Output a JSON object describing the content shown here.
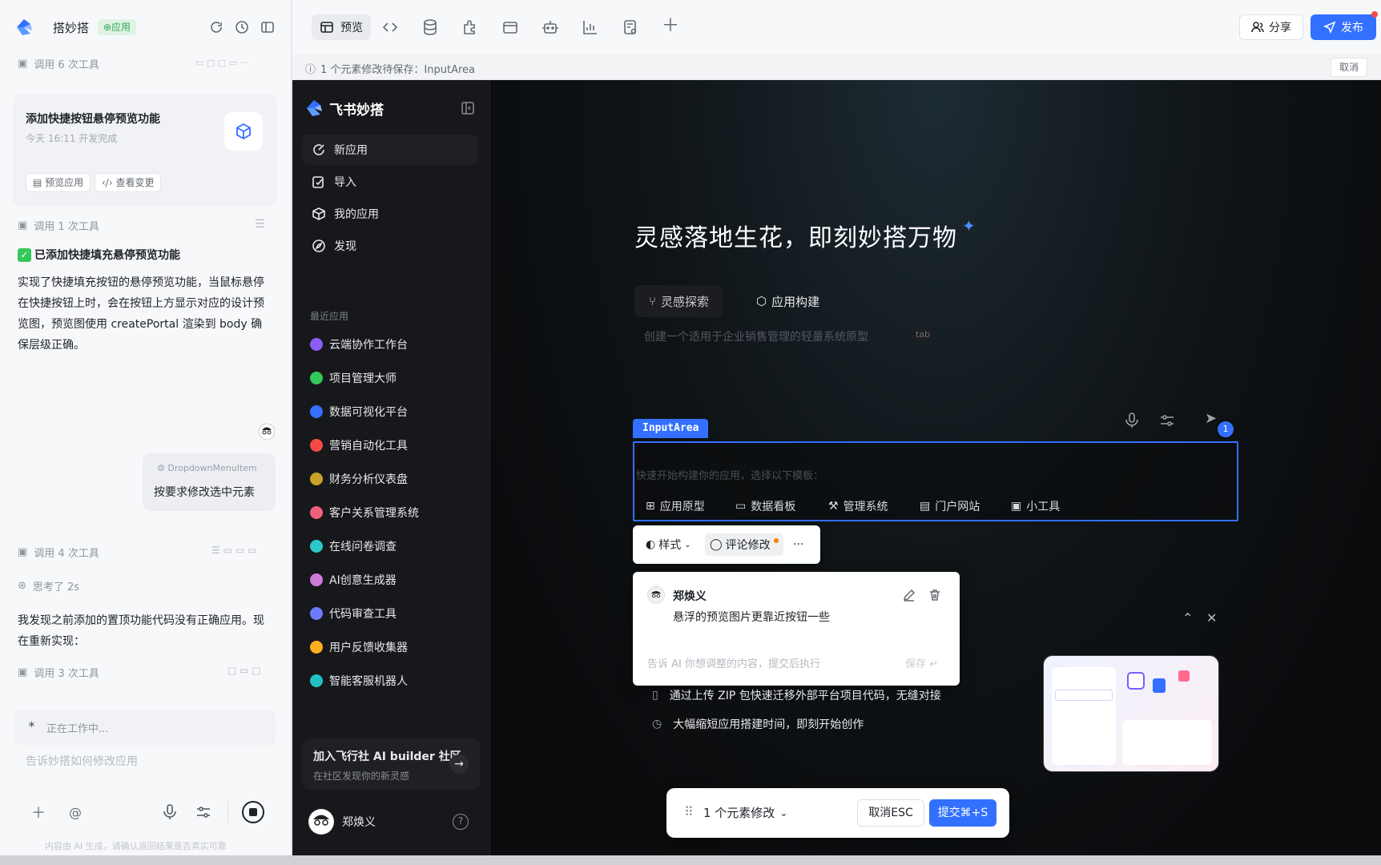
{
  "left_panel": {
    "app_name": "搭妙搭",
    "app_badge": "⊕应用",
    "tool_call_1": "调用 6 次工具",
    "card": {
      "title": "添加快捷按钮悬停预览功能",
      "subtitle": "今天 16:11 开发完成",
      "preview_chip": "预览应用",
      "changes_chip": "查看变更"
    },
    "tool_call_2": "调用 1 次工具",
    "done_title": "已添加快捷填充悬停预览功能",
    "done_body": "实现了快捷填充按钮的悬停预览功能，当鼠标悬停在快捷按钮上时，会在按钮上方显示对应的设计预览图，预览图使用 createPortal 渲染到 body 确保层级正确。",
    "bubble_tag": "DropdownMenuItem",
    "bubble_text": "按要求修改选中元素",
    "tool_call_3": "调用 4 次工具",
    "thinking": "思考了 2s",
    "reply": "我发现之前添加的置顶功能代码没有正确应用。现在重新实现：",
    "tool_call_4": "调用 3 次工具",
    "working": "正在工作中...",
    "input_placeholder": "告诉妙搭如何修改应用",
    "footnote": "内容由 AI 生成，请确认返回结果是否真实可靠"
  },
  "toolbar": {
    "preview_tab": "预览",
    "share": "分享",
    "publish": "发布"
  },
  "infobar": {
    "message": "1 个元素修改待保存：InputArea",
    "cancel": "取消"
  },
  "sidebar": {
    "brand": "飞书妙搭",
    "nav": [
      {
        "label": "新应用"
      },
      {
        "label": "导入"
      },
      {
        "label": "我的应用"
      },
      {
        "label": "发现"
      }
    ],
    "section": "最近应用",
    "apps": [
      {
        "label": "云端协作工作台",
        "color": "#8b5cf6"
      },
      {
        "label": "项目管理大师",
        "color": "#34c759"
      },
      {
        "label": "数据可视化平台",
        "color": "#3370ff"
      },
      {
        "label": "营销自动化工具",
        "color": "#f54a45"
      },
      {
        "label": "财务分析仪表盘",
        "color": "#c9a227"
      },
      {
        "label": "客户关系管理系统",
        "color": "#f0607a"
      },
      {
        "label": "在线问卷调查",
        "color": "#2ec7c9"
      },
      {
        "label": "AI创意生成器",
        "color": "#d07ad8"
      },
      {
        "label": "代码审查工具",
        "color": "#6b7cff"
      },
      {
        "label": "用户反馈收集器",
        "color": "#ffb020"
      },
      {
        "label": "智能客服机器人",
        "color": "#22c1c3"
      }
    ],
    "promo_title": "加入飞行社 AI builder 社区",
    "promo_sub": "在社区发现你的新灵感",
    "user_name": "郑焕义"
  },
  "main": {
    "hero": "灵感落地生花，即刻妙搭万物",
    "tabs": [
      {
        "label": "灵感探索"
      },
      {
        "label": "应用构建"
      }
    ],
    "hint": "创建一个适用于企业销售管理的轻量系统原型",
    "tab_key": "tab",
    "selection_label": "InputArea",
    "input_placeholder": "快速开始构建你的应用，选择以下模板：",
    "templates": [
      {
        "label": "应用原型"
      },
      {
        "label": "数据看板"
      },
      {
        "label": "管理系统"
      },
      {
        "label": "门户网站"
      },
      {
        "label": "小工具"
      }
    ],
    "badge_count": "1",
    "popbar": {
      "style": "样式",
      "comment": "评论修改",
      "more": "···"
    },
    "comment": {
      "author": "郑焕义",
      "text": "悬浮的预览图片更靠近按钮一些",
      "input_placeholder": "告诉 AI 你想调整的内容，提交后执行",
      "save": "保存 ↵"
    },
    "features": [
      {
        "label": "通过上传 ZIP 包快速迁移外部平台项目代码，无缝对接"
      },
      {
        "label": "大幅缩短应用搭建时间，即刻开始创作"
      }
    ],
    "bottom_bar": {
      "count": "1 个元素修改",
      "cancel": "取消ESC",
      "submit": "提交⌘+S"
    }
  },
  "colors": {
    "accent": "#3370ff",
    "success": "#34c759",
    "dark_bg": "#0c0d0f"
  }
}
